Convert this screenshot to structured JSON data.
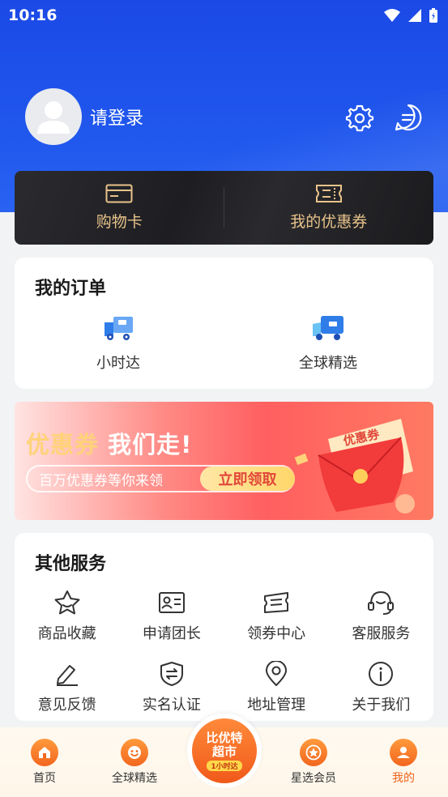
{
  "status_bar": {
    "time": "10:16"
  },
  "profile": {
    "login_text": "请登录"
  },
  "quick_cards": [
    {
      "label": "购物卡",
      "icon": "card-icon"
    },
    {
      "label": "我的优惠券",
      "icon": "ticket-icon"
    }
  ],
  "orders": {
    "title": "我的订单",
    "items": [
      {
        "label": "小时达",
        "icon": "truck-fast-icon"
      },
      {
        "label": "全球精选",
        "icon": "delivery-truck-icon"
      }
    ]
  },
  "banner": {
    "title_highlight": "优惠券",
    "title_rest": "我们走!",
    "subtitle": "百万优惠券等你来领",
    "button": "立即领取",
    "art_text": "优惠券"
  },
  "services": {
    "title": "其他服务",
    "items": [
      {
        "label": "商品收藏",
        "icon": "star-icon"
      },
      {
        "label": "申请团长",
        "icon": "id-card-icon"
      },
      {
        "label": "领券中心",
        "icon": "coupon-icon"
      },
      {
        "label": "客服服务",
        "icon": "headset-icon"
      },
      {
        "label": "意见反馈",
        "icon": "pencil-icon"
      },
      {
        "label": "实名认证",
        "icon": "shield-icon"
      },
      {
        "label": "地址管理",
        "icon": "location-pin-icon"
      },
      {
        "label": "关于我们",
        "icon": "info-icon"
      }
    ]
  },
  "tabbar": {
    "tabs": [
      {
        "label": "首页",
        "icon": "home-icon"
      },
      {
        "label": "全球精选",
        "icon": "smile-icon"
      },
      {
        "label": "星选会员",
        "icon": "star-badge-icon"
      },
      {
        "label": "我的",
        "icon": "user-icon",
        "active": true
      }
    ],
    "center": {
      "line1": "比优特",
      "line2": "超市",
      "line3": "1小时达"
    }
  },
  "colors": {
    "primary_blue": "#1b49e6",
    "accent_orange": "#f0641c",
    "gold": "#e8c38a"
  }
}
